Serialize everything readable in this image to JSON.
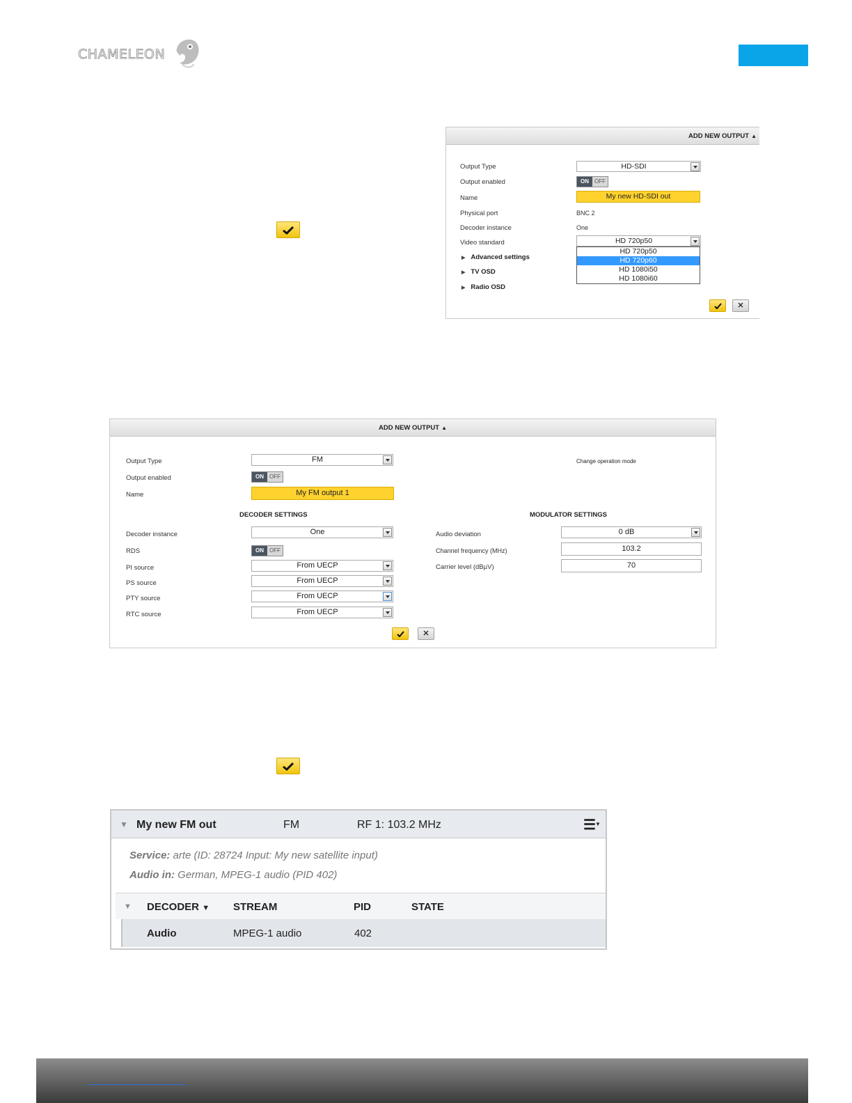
{
  "header": {
    "logo_text": "CHAMELEON",
    "accent_color": "#0aa5e8"
  },
  "hd_panel": {
    "title": "ADD NEW OUTPUT",
    "output_type_label": "Output Type",
    "output_type_value": "HD-SDI",
    "output_enabled_label": "Output enabled",
    "toggle_on": "ON",
    "toggle_off": "OFF",
    "name_label": "Name",
    "name_value": "My new HD-SDI out",
    "physical_port_label": "Physical port",
    "physical_port_value": "BNC 2",
    "decoder_instance_label": "Decoder instance",
    "decoder_instance_value": "One",
    "video_standard_label": "Video standard",
    "video_standard_value": "HD 720p50",
    "video_standard_options": [
      "HD 720p50",
      "HD 720p60",
      "HD 1080i50",
      "HD 1080i60"
    ],
    "advanced_settings": "Advanced settings",
    "tv_osd": "TV OSD",
    "radio_osd": "Radio OSD"
  },
  "fm_panel": {
    "title": "ADD NEW OUTPUT",
    "output_type_label": "Output Type",
    "output_type_value": "FM",
    "output_enabled_label": "Output enabled",
    "toggle_on": "ON",
    "toggle_off": "OFF",
    "name_label": "Name",
    "name_value": "My FM output 1",
    "change_mode": "Change operation mode",
    "decoder_settings_title": "DECODER SETTINGS",
    "modulator_settings_title": "MODULATOR SETTINGS",
    "decoder_instance_label": "Decoder instance",
    "decoder_instance_value": "One",
    "rds_label": "RDS",
    "pi_source_label": "PI source",
    "pi_source_value": "From UECP",
    "ps_source_label": "PS source",
    "ps_source_value": "From UECP",
    "pty_source_label": "PTY source",
    "pty_source_value": "From UECP",
    "rtc_source_label": "RTC source",
    "rtc_source_value": "From UECP",
    "audio_deviation_label": "Audio deviation",
    "audio_deviation_value": "0 dB",
    "channel_frequency_label": "Channel frequency (MHz)",
    "channel_frequency_value": "103.2",
    "carrier_level_label": "Carrier level (dBµV)",
    "carrier_level_value": "70"
  },
  "output_card": {
    "name": "My new FM out",
    "type": "FM",
    "rf": "RF 1: 103.2 MHz",
    "service_label": "Service:",
    "service_value": "arte (ID: 28724 Input: My new satellite input)",
    "audio_in_label": "Audio in:",
    "audio_in_value": "German, MPEG-1 audio (PID 402)",
    "columns": [
      "DECODER",
      "STREAM",
      "PID",
      "STATE"
    ],
    "rows": [
      {
        "decoder": "Audio",
        "stream": "MPEG-1 audio",
        "pid": "402",
        "state": ""
      }
    ]
  }
}
